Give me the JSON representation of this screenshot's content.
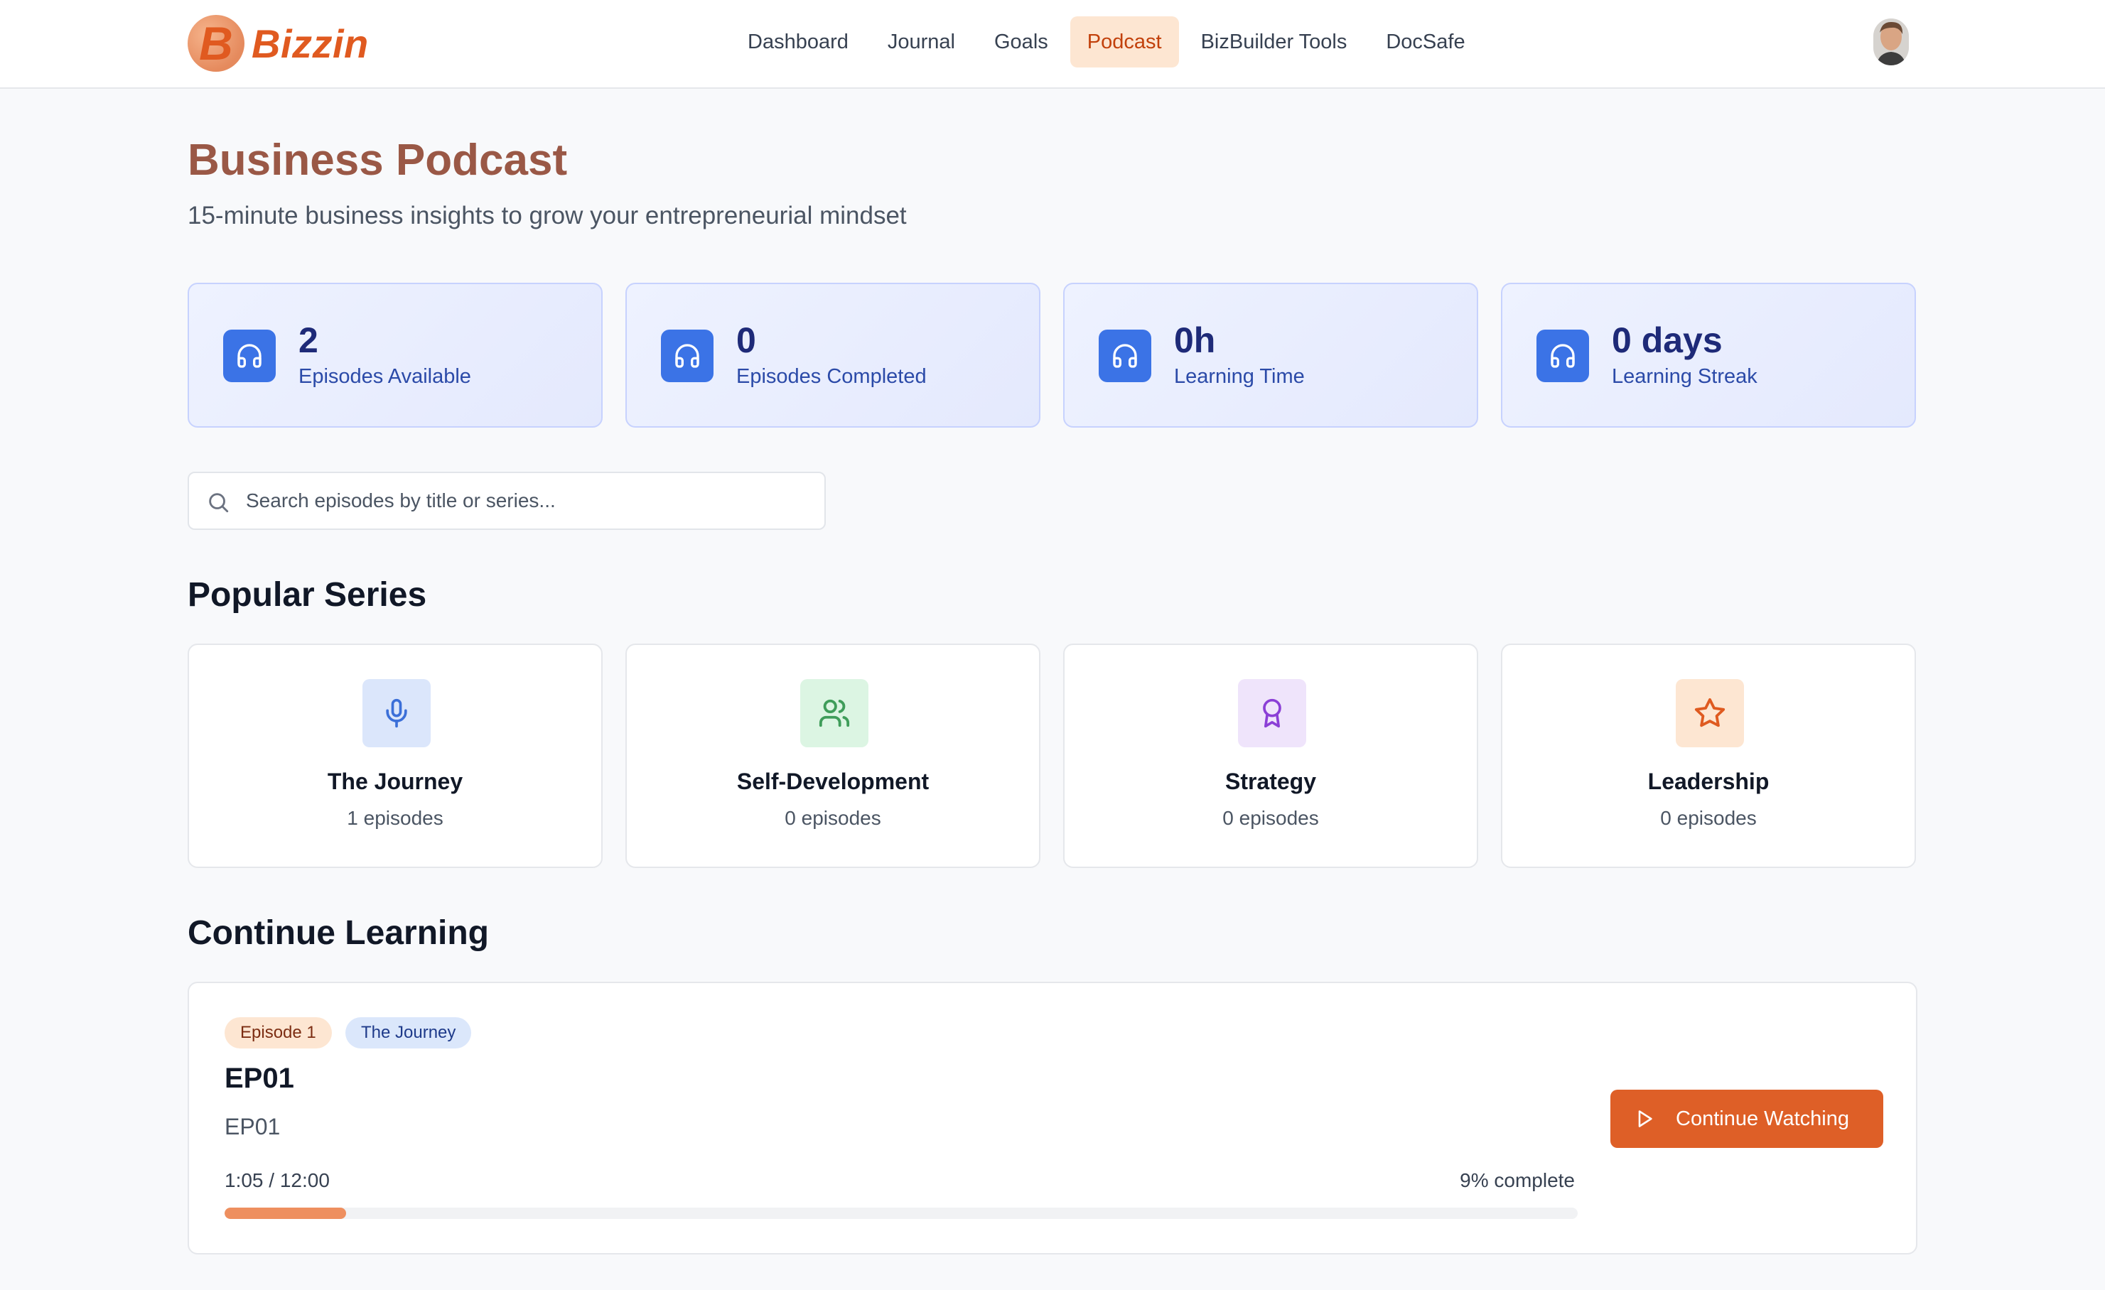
{
  "app": {
    "brand_initial": "B",
    "brand_name": "Bizzin"
  },
  "nav": {
    "items": [
      {
        "label": "Dashboard",
        "active": false
      },
      {
        "label": "Journal",
        "active": false
      },
      {
        "label": "Goals",
        "active": false
      },
      {
        "label": "Podcast",
        "active": true
      },
      {
        "label": "BizBuilder Tools",
        "active": false
      },
      {
        "label": "DocSafe",
        "active": false
      }
    ]
  },
  "header": {
    "title": "Business Podcast",
    "subtitle": "15-minute business insights to grow your entrepreneurial mindset"
  },
  "stats": [
    {
      "value": "2",
      "label": "Episodes Available",
      "icon": "headphones-icon"
    },
    {
      "value": "0",
      "label": "Episodes Completed",
      "icon": "headphones-icon"
    },
    {
      "value": "0h",
      "label": "Learning Time",
      "icon": "headphones-icon"
    },
    {
      "value": "0 days",
      "label": "Learning Streak",
      "icon": "headphones-icon"
    }
  ],
  "search": {
    "placeholder": "Search episodes by title or series...",
    "value": ""
  },
  "popular_series": {
    "title": "Popular Series",
    "items": [
      {
        "name": "The Journey",
        "count": "1 episodes",
        "icon": "microphone-icon",
        "icon_color": "#3b6fd8",
        "icon_bg": "#dbe6fb"
      },
      {
        "name": "Self-Development",
        "count": "0 episodes",
        "icon": "users-icon",
        "icon_color": "#3f9d5a",
        "icon_bg": "#dcf5e3"
      },
      {
        "name": "Strategy",
        "count": "0 episodes",
        "icon": "award-icon",
        "icon_color": "#8b3fd6",
        "icon_bg": "#efe4fb"
      },
      {
        "name": "Leadership",
        "count": "0 episodes",
        "icon": "star-icon",
        "icon_color": "#df5a20",
        "icon_bg": "#fde6d2"
      }
    ]
  },
  "continue_learning": {
    "title": "Continue Learning",
    "episode_badge": "Episode 1",
    "series_badge": "The Journey",
    "episode_title": "EP01",
    "episode_description": "EP01",
    "time": "1:05 / 12:00",
    "percent_label": "9% complete",
    "progress": 0.09,
    "button_label": "Continue Watching"
  },
  "colors": {
    "accent": "#de5f27",
    "stat_icon": "#3b73e6",
    "title": "#9a5846"
  }
}
